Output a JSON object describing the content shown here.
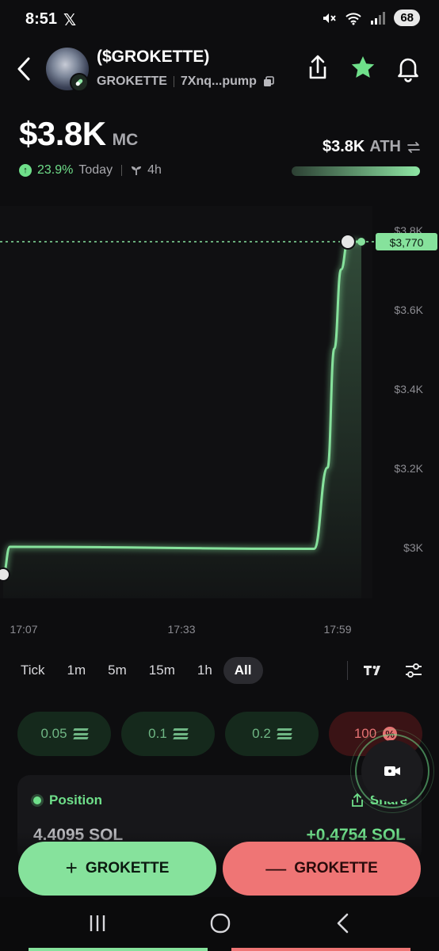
{
  "status_bar": {
    "time": "8:51",
    "app_icon": "x-logo",
    "battery": "68",
    "network": "5"
  },
  "header": {
    "title": "($GROKETTE)",
    "symbol": "GROKETTE",
    "address": "7Xnq...pump",
    "icons": [
      "back-icon",
      "share-icon",
      "star-icon",
      "bell-icon",
      "copy-icon",
      "pill-icon"
    ]
  },
  "market": {
    "mc_value": "$3.8K",
    "mc_label": "MC",
    "change_pct": "23.9%",
    "change_period": "Today",
    "age": "4h",
    "ath_value": "$3.8K",
    "ath_label": "ATH",
    "ath_progress": 1.0
  },
  "chart_data": {
    "type": "line",
    "x_ticks": [
      "17:07",
      "17:33",
      "17:59"
    ],
    "y_ticks": [
      "$3.8K",
      "$3.6K",
      "$3.4K",
      "$3.2K",
      "$3K"
    ],
    "y_tick_values": [
      3800,
      3600,
      3400,
      3200,
      3000
    ],
    "ylim": [
      2950,
      3830
    ],
    "current_price_label": "$3,770",
    "current_price": 3770,
    "series": [
      {
        "values": [
          {
            "t": "17:07",
            "y": 2930
          },
          {
            "t": "17:08",
            "y": 3000
          },
          {
            "t": "17:53",
            "y": 2995
          },
          {
            "t": "17:55",
            "y": 3200
          },
          {
            "t": "17:56",
            "y": 3500
          },
          {
            "t": "17:57",
            "y": 3700
          },
          {
            "t": "17:58",
            "y": 3770
          },
          {
            "t": "18:00",
            "y": 3770
          }
        ]
      }
    ],
    "color": "#86e29c"
  },
  "timeframes": {
    "items": [
      "Tick",
      "1m",
      "5m",
      "15m",
      "1h",
      "All"
    ],
    "active": "All"
  },
  "amount_chips": [
    {
      "label": "0.05",
      "kind": "buy"
    },
    {
      "label": "0.1",
      "kind": "buy"
    },
    {
      "label": "0.2",
      "kind": "buy"
    },
    {
      "label": "100",
      "kind": "sell"
    }
  ],
  "position": {
    "title": "Position",
    "share_label": "Share",
    "amount": "4.4095 SOL",
    "pnl": "+0.4754 SOL"
  },
  "actions": {
    "buy_label": "GROKETTE",
    "sell_label": "GROKETTE",
    "buy_sign": "+",
    "sell_sign": "—"
  },
  "colors": {
    "accent_green": "#86e29c",
    "accent_red": "#ef7575",
    "background": "#0d0d0f"
  }
}
